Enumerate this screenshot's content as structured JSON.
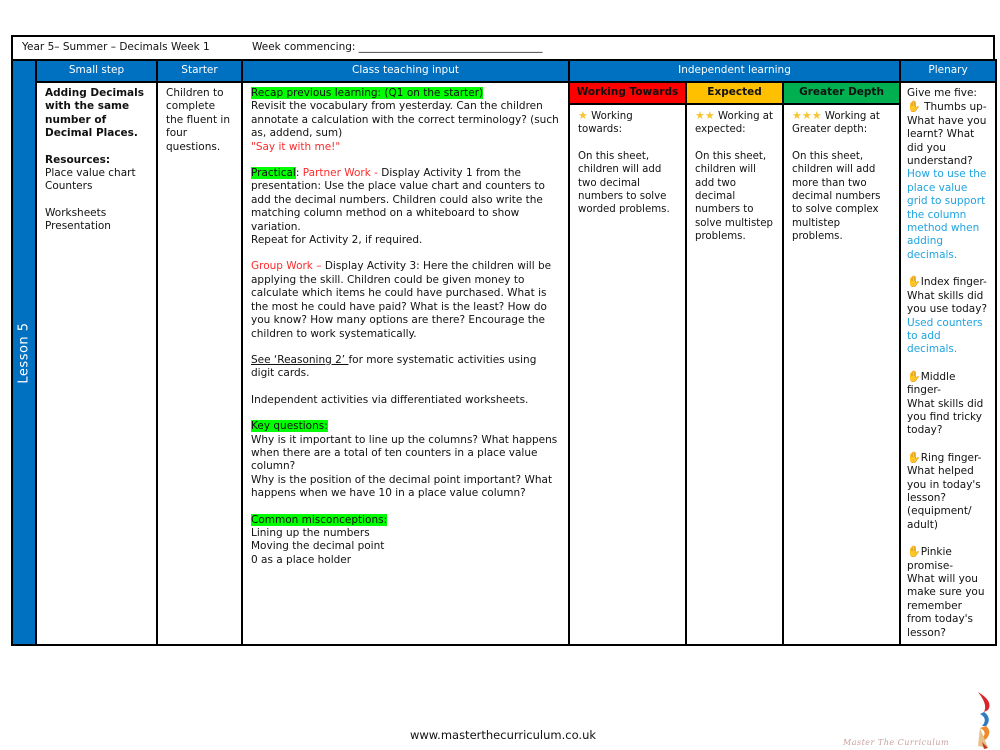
{
  "header": {
    "title": "Year 5– Summer – Decimals Week 1",
    "week_commencing": "Week commencing: ___________________________________"
  },
  "columns": {
    "small_step": "Small step",
    "starter": "Starter",
    "class_teaching": "Class teaching input",
    "independent": "Independent learning",
    "plenary": "Plenary"
  },
  "differentiation": {
    "working_towards": "Working Towards",
    "expected": "Expected",
    "greater_depth": "Greater Depth"
  },
  "lesson_label": "Lesson 5",
  "small_step": {
    "title": "Adding Decimals with the same number of Decimal Places.",
    "resources_label": "Resources:",
    "resources": [
      "Place value chart",
      "Counters"
    ],
    "resources_2": [
      "Worksheets",
      "Presentation"
    ]
  },
  "starter": {
    "text": "Children to complete the fluent in four questions."
  },
  "teaching": {
    "recap_heading": "Recap previous learning: (Q1 on the starter)",
    "recap_text": "Revisit the vocabulary from yesterday. Can the children annotate a calculation with the correct terminology? (such as, addend, sum)",
    "recap_say": "\"Say it with me!\"",
    "practical_label": "Practical",
    "practical_sep": ": ",
    "partner_work": "Partner Work - ",
    "practical_text": "Display Activity 1 from the presentation: Use the place value chart and counters to add the decimal numbers. Children could also write the matching column method on a whiteboard to show variation.",
    "practical_repeat": "Repeat for Activity 2, if required.",
    "group_work": "Group Work – ",
    "group_text": "Display Activity 3: Here the children will be applying the skill. Children could be given money to calculate which items he could have purchased. What is the most he could have paid? What is the least? How do you know? How many options are there? Encourage the children to work systematically.",
    "reasoning_link": "See ‘Reasoning 2’ ",
    "reasoning_text": "for more systematic activities using digit cards.",
    "independent_text": "Independent activities via differentiated worksheets.",
    "key_questions_heading": "Key questions:",
    "key_questions": [
      "Why is it important to line up the columns? What happens when there are a total of ten counters in a place value column?",
      "Why is the position of the decimal point important? What happens when we have 10 in a place value column?"
    ],
    "misconceptions_heading": "Common misconceptions:",
    "misconceptions": [
      "Lining up the numbers",
      "Moving the decimal point",
      "0 as a place holder"
    ]
  },
  "independent": {
    "working_towards": {
      "stars": "★",
      "heading": "Working towards:",
      "text": "On this sheet, children will add two decimal numbers to solve worded problems."
    },
    "expected": {
      "stars": "★★",
      "heading": "Working at expected:",
      "text": "On this sheet, children will add two decimal numbers to solve multistep problems."
    },
    "greater_depth": {
      "stars": "★★★",
      "heading": "Working at Greater depth:",
      "text": "On this sheet, children will add more than two decimal numbers to solve complex multistep problems."
    }
  },
  "plenary": {
    "intro": "Give me five:",
    "hand_icon": "✋",
    "items": [
      {
        "finger": "Thumbs up-",
        "question": "What have you learnt? What did you understand?",
        "answer": "How to use the place value grid to support the column method when adding decimals."
      },
      {
        "finger": "Index finger-",
        "question": "What skills did you use today?",
        "answer": "Used counters to add decimals."
      },
      {
        "finger": "Middle finger-",
        "question": "What skills did you find tricky today?",
        "answer": ""
      },
      {
        "finger": "Ring finger-",
        "question": "What helped you in today's lesson? (equipment/ adult)",
        "answer": ""
      },
      {
        "finger": "Pinkie promise-",
        "question": "What will you make sure you remember from today's lesson?",
        "answer": ""
      }
    ]
  },
  "footer": {
    "url": "www.masterthecurriculum.co.uk",
    "logo_text": "Master The Curriculum"
  },
  "colors": {
    "header_blue": "#0070c0",
    "working_towards": "#ff0000",
    "expected": "#ffc000",
    "greater_depth": "#00b050",
    "highlight": "#00ff00",
    "red_text": "#ff2a2a",
    "blue_text": "#1fa3e0"
  }
}
